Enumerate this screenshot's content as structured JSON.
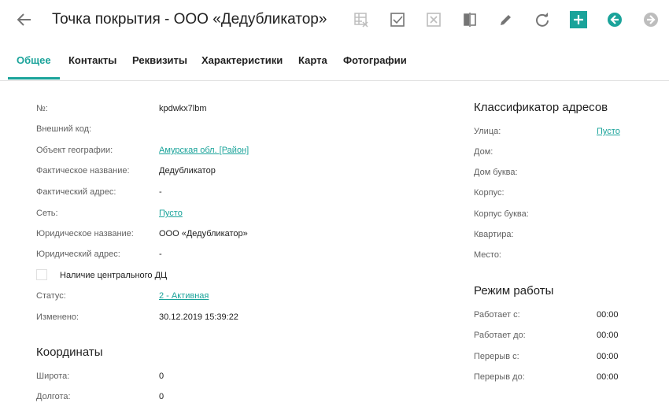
{
  "header": {
    "title": "Точка покрытия - ООО «Дедубликатор»",
    "icons": [
      "arrow-left-icon",
      "table-delete-icon",
      "checkbox-checked-icon",
      "checkbox-cross-icon",
      "compare-icon",
      "pencil-icon",
      "refresh-icon",
      "plus-icon",
      "circle-arrow-left-icon",
      "circle-arrow-right-icon"
    ]
  },
  "colors": {
    "accent": "#1aa39a",
    "icon_gray": "#757575",
    "disabled": "#bdbdbd"
  },
  "tabs": [
    {
      "label": "Общее",
      "active": true
    },
    {
      "label": "Контакты"
    },
    {
      "label": "Реквизиты"
    },
    {
      "label": "Характеристики"
    },
    {
      "label": "Карта"
    },
    {
      "label": "Фотографии"
    }
  ],
  "general": {
    "number": {
      "label": "№:",
      "value": "kpdwkx7lbm"
    },
    "external_code": {
      "label": "Внешний код:"
    },
    "geo_object": {
      "label": "Объект географии:",
      "value": "Амурская обл. [Район]"
    },
    "actual_name": {
      "label": "Фактическое название:",
      "value": "Дедубликатор"
    },
    "actual_address": {
      "label": "Фактический адрес:",
      "value": "-"
    },
    "network": {
      "label": "Сеть:",
      "value": "Пусто"
    },
    "legal_name": {
      "label": "Юридическое название:",
      "value": "ООО «Дедубликатор»"
    },
    "legal_address": {
      "label": "Юридический адрес:",
      "value": "-"
    },
    "central_dc": {
      "label": "Наличие центрального ДЦ"
    },
    "status": {
      "label": "Статус:",
      "value": "2 - Активная"
    },
    "modified": {
      "label": "Изменено:",
      "value": "30.12.2019 15:39:22"
    }
  },
  "coordinates": {
    "title": "Координаты",
    "latitude": {
      "label": "Широта:",
      "value": "0"
    },
    "longitude": {
      "label": "Долгота:",
      "value": "0"
    }
  },
  "address_classifier": {
    "title": "Классификатор адресов",
    "street": {
      "label": "Улица:",
      "value": "Пусто"
    },
    "house": {
      "label": "Дом:"
    },
    "house_letter": {
      "label": "Дом буква:"
    },
    "building": {
      "label": "Корпус:"
    },
    "building_letter": {
      "label": "Корпус буква:"
    },
    "apartment": {
      "label": "Квартира:"
    },
    "place": {
      "label": "Место:"
    }
  },
  "work_schedule": {
    "title": "Режим работы",
    "works_from": {
      "label": "Работает с:",
      "value": "00:00"
    },
    "works_to": {
      "label": "Работает до:",
      "value": "00:00"
    },
    "break_from": {
      "label": "Перерыв с:",
      "value": "00:00"
    },
    "break_to": {
      "label": "Перерыв до:",
      "value": "00:00"
    }
  }
}
